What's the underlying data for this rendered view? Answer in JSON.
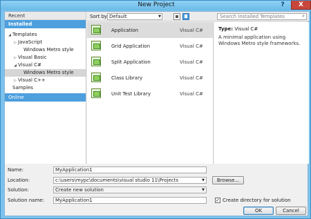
{
  "window": {
    "title": "New Project",
    "help_label": "?",
    "close_label": "X"
  },
  "sidebar": {
    "recent": "Recent",
    "installed": "Installed",
    "tree": [
      {
        "label": "Templates",
        "arrow": "◢"
      },
      {
        "label": "JavaScript",
        "arrow": "▷"
      },
      {
        "label": "Windows Metro style",
        "arrow": ""
      },
      {
        "label": "Visual Basic",
        "arrow": "▷"
      },
      {
        "label": "Visual C#",
        "arrow": "◢"
      },
      {
        "label": "Windows Metro style",
        "arrow": ""
      },
      {
        "label": "Visual C++",
        "arrow": "▷"
      },
      {
        "label": "Samples",
        "arrow": ""
      }
    ],
    "online": "Online"
  },
  "toolbar": {
    "sort_by_label": "Sort by:",
    "sort_value": "Default",
    "search_placeholder": "Search Installed Templates"
  },
  "templates": [
    {
      "name": "Application",
      "lang": "Visual C#"
    },
    {
      "name": "Grid Application",
      "lang": "Visual C#"
    },
    {
      "name": "Split Application",
      "lang": "Visual C#"
    },
    {
      "name": "Class Library",
      "lang": "Visual C#"
    },
    {
      "name": "Unit Test Library",
      "lang": "Visual C#"
    }
  ],
  "detail": {
    "type_label": "Type:",
    "type_value": "Visual C#",
    "description": "A minimal application using Windows Metro style frameworks."
  },
  "form": {
    "name_label": "Name:",
    "name_value": "MyApplication1",
    "location_label": "Location:",
    "location_value": "c:\\users\\mypc\\documents\\visual studio 11\\Projects",
    "browse_label": "Browse...",
    "solution_label": "Solution:",
    "solution_value": "Create new solution",
    "solution_name_label": "Solution name:",
    "solution_name_value": "MyApplication1",
    "create_dir_label": "Create directory for solution",
    "create_dir_checked": "✓",
    "ok_label": "OK",
    "cancel_label": "Cancel"
  }
}
